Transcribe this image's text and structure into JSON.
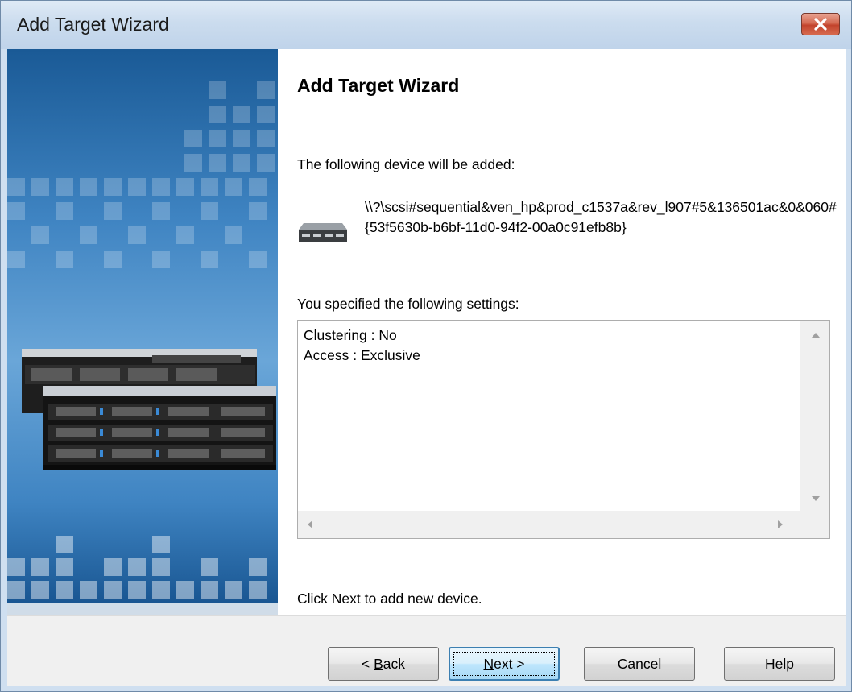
{
  "window": {
    "title": "Add Target Wizard"
  },
  "content": {
    "heading": "Add Target Wizard",
    "intro": "The following device will be added:",
    "device_path": "\\\\?\\scsi#sequential&ven_hp&prod_c1537a&rev_l907#5&136501ac&0&060#{53f5630b-b6bf-11d0-94f2-00a0c91efb8b}",
    "settings_label": "You specified the following settings:",
    "settings": [
      "Clustering : No",
      "Access : Exclusive"
    ],
    "footer_note": "Click Next to add new device."
  },
  "buttons": {
    "back": {
      "prefix": "< ",
      "mnemonic": "B",
      "rest": "ack"
    },
    "next": {
      "mnemonic": "N",
      "rest": "ext >"
    },
    "cancel": "Cancel",
    "help": "Help"
  },
  "icons": {
    "close": "close-icon",
    "device": "tape-drive-icon",
    "banner": "server-rack-image"
  },
  "colors": {
    "close_button": "#c2432c",
    "side_panel": "#3f84c2",
    "default_button_border": "#3c7fb1"
  }
}
